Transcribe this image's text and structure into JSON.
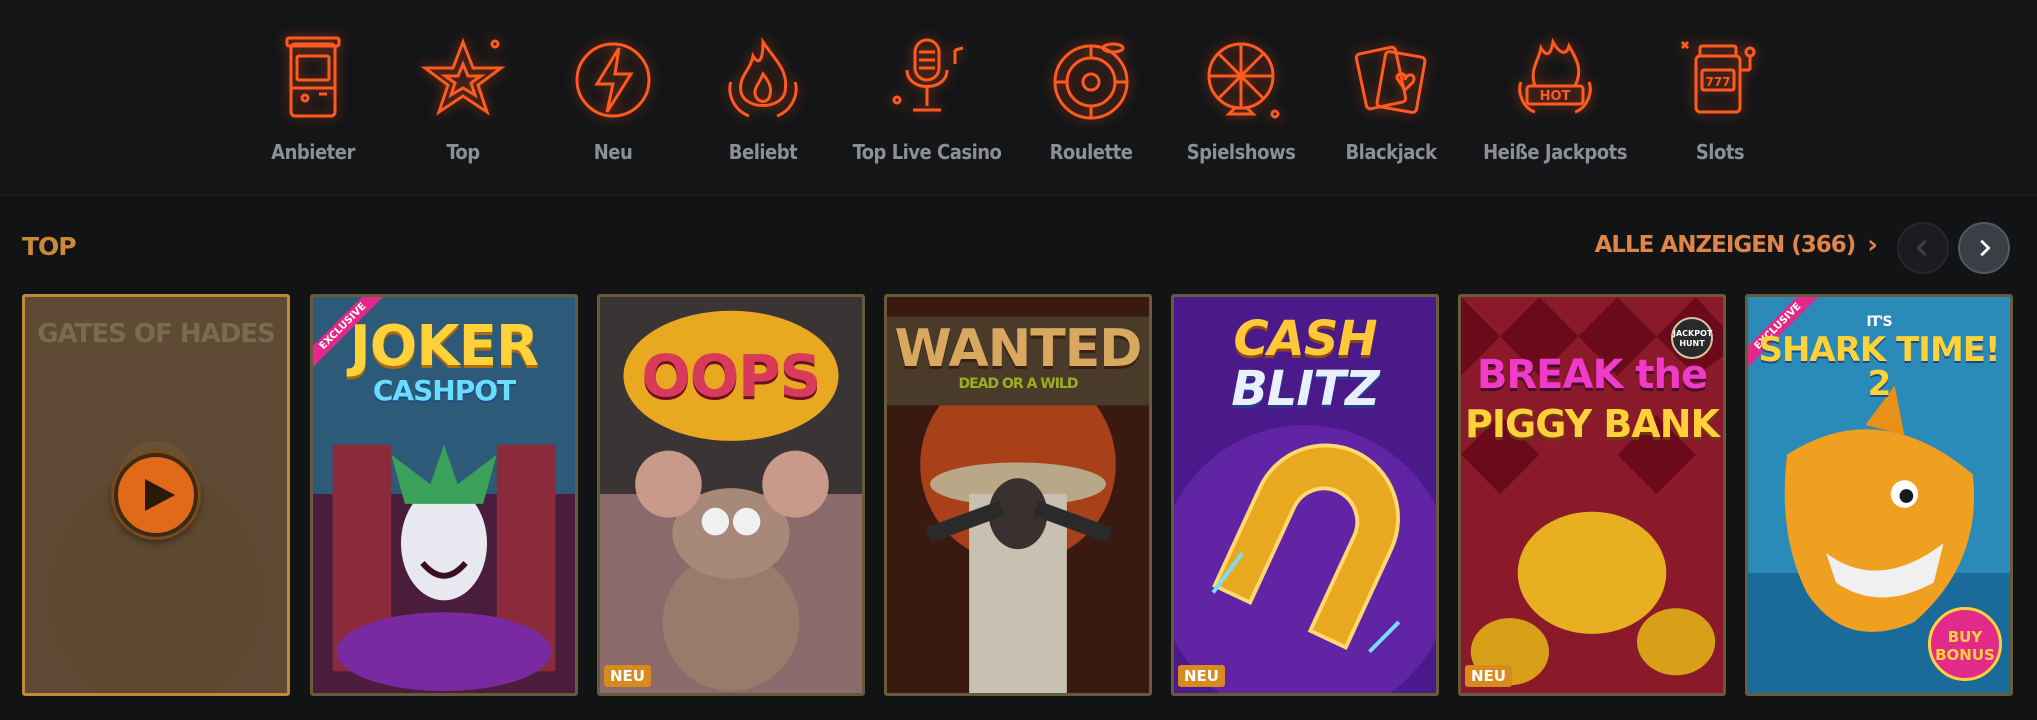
{
  "nav": {
    "items": [
      {
        "label": "Anbieter",
        "icon": "arcade-machine-icon"
      },
      {
        "label": "Top",
        "icon": "star-icon"
      },
      {
        "label": "Neu",
        "icon": "lightning-icon"
      },
      {
        "label": "Beliebt",
        "icon": "flame-icon"
      },
      {
        "label": "Top Live Casino",
        "icon": "microphone-icon"
      },
      {
        "label": "Roulette",
        "icon": "roulette-icon"
      },
      {
        "label": "Spielshows",
        "icon": "wheel-of-fortune-icon"
      },
      {
        "label": "Blackjack",
        "icon": "playing-cards-icon"
      },
      {
        "label": "Heiße Jackpots",
        "icon": "hot-jackpot-icon"
      },
      {
        "label": "Slots",
        "icon": "slot-machine-icon"
      }
    ],
    "icon_color": "#ff5a1f"
  },
  "section": {
    "title": "TOP",
    "view_all_label": "ALLE ANZEIGEN (366)",
    "view_all_chevron": "›"
  },
  "games": [
    {
      "title": "GATES OF HADES",
      "badge": "",
      "ribbon": "",
      "hovered": true
    },
    {
      "title": "JOKER",
      "subtitle": "CASHPOT",
      "badge": "",
      "ribbon": "EXCLUSIVE"
    },
    {
      "title": "OOPS",
      "badge": "NEU",
      "ribbon": ""
    },
    {
      "title": "WANTED",
      "subtitle": "DEAD OR A WILD",
      "badge": "",
      "ribbon": ""
    },
    {
      "title": "CASH",
      "subtitle": "BLITZ",
      "badge": "NEU",
      "ribbon": ""
    },
    {
      "title": "BREAK the",
      "subtitle": "PIGGY BANK",
      "logo": "JACKPOT HUNT",
      "badge": "NEU",
      "ribbon": ""
    },
    {
      "title": "SHARK TIME! 2",
      "pretitle": "IT'S",
      "stamp": "BUY BONUS",
      "badge": "",
      "ribbon": "EXCLUSIVE"
    }
  ],
  "colors": {
    "accent": "#e0854a",
    "section_title": "#c9883a",
    "badge_new": "#d98a1e",
    "ribbon": "#e2298a"
  }
}
